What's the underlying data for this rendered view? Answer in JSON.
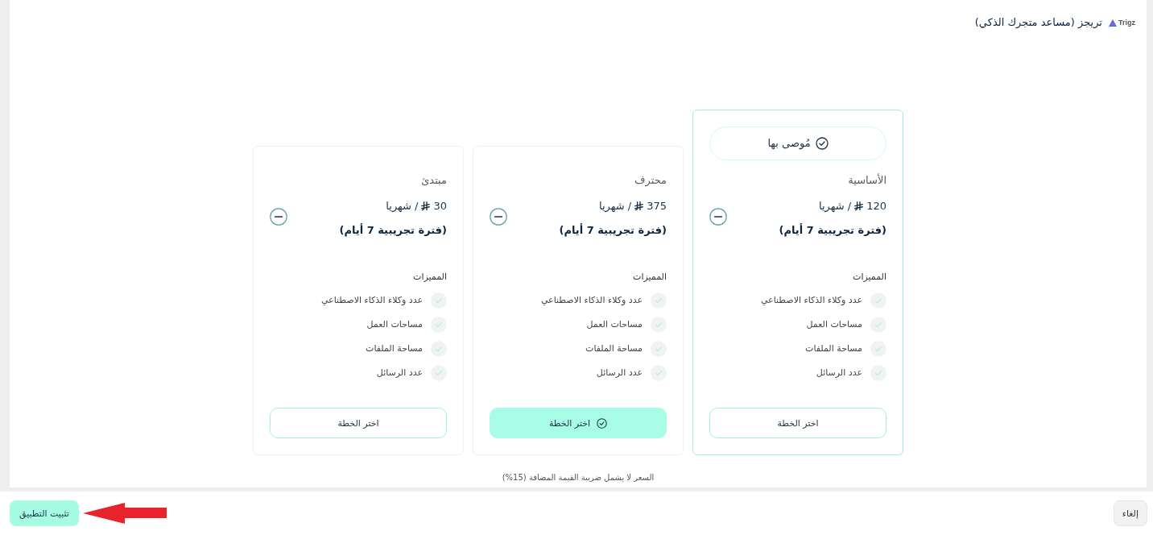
{
  "header": {
    "logo_text": "Trigz",
    "title": "تريجز (مساعد متجرك الذكي)"
  },
  "plans": [
    {
      "recommended": true,
      "badge": "مُوصى بها",
      "name": "الأساسية",
      "price": "120",
      "period": "/ شهريا",
      "trial": "(فترة تجريبية 7 أيام)",
      "features_title": "المميزات",
      "features": [
        "عدد وكلاء الذكاء الاصطناعي",
        "مساحات العمل",
        "مساحة الملفات",
        "عدد الرسائل"
      ],
      "button": {
        "label": "اختر الخطة",
        "selected": false
      }
    },
    {
      "recommended": false,
      "name": "محترف",
      "price": "375",
      "period": "/ شهريا",
      "trial": "(فترة تجريبية 7 أيام)",
      "features_title": "المميزات",
      "features": [
        "عدد وكلاء الذكاء الاصطناعي",
        "مساحات العمل",
        "مساحة الملفات",
        "عدد الرسائل"
      ],
      "button": {
        "label": "اختر الخطة",
        "selected": true
      }
    },
    {
      "recommended": false,
      "name": "مبتدئ",
      "price": "30",
      "period": "/ شهريا",
      "trial": "(فترة تجريبية 7 أيام)",
      "features_title": "المميزات",
      "features": [
        "عدد وكلاء الذكاء الاصطناعي",
        "مساحات العمل",
        "مساحة الملفات",
        "عدد الرسائل"
      ],
      "button": {
        "label": "اختر الخطة",
        "selected": false
      }
    }
  ],
  "tax_note": "السعر لا يشمل ضريبة القيمة المضافة (15%)",
  "footer": {
    "cancel_button": "إلغاء",
    "install_button": "تثبيت التطبيق"
  }
}
